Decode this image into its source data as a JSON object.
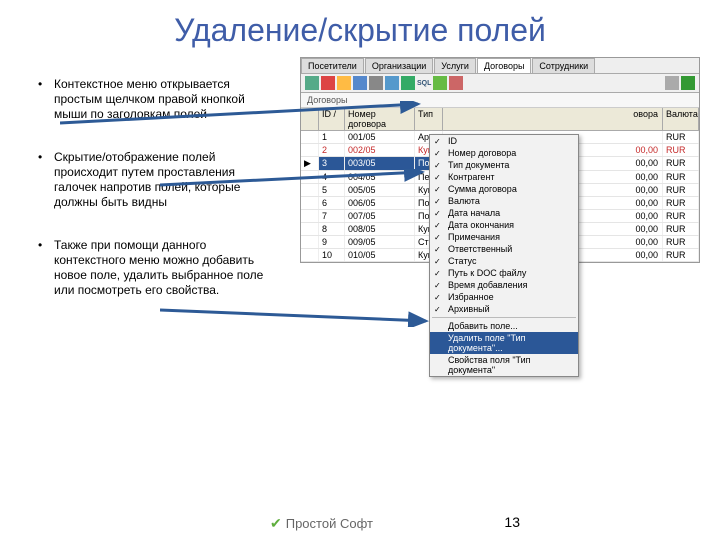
{
  "title": "Удаление/скрытие полей",
  "bullets": [
    "Контекстное меню открывается простым щелчком правой кнопкой мыши по заголовкам полей",
    "Скрытие/отображение полей происходит путем проставления галочек напротив полей, которые должны быть видны",
    "Также при помощи данного контекстного меню можно добавить новое поле, удалить выбранное поле или посмотреть его свойства."
  ],
  "tabs": [
    "Посетители",
    "Организации",
    "Услуги",
    "Договоры",
    "Сотрудники"
  ],
  "section_label": "Договоры",
  "headers": {
    "id": "ID /",
    "num": "Номер договора",
    "type": "Тип",
    "sum_col": "овора",
    "cur": "Валюта"
  },
  "rows": [
    {
      "i": "1",
      "num": "001/05",
      "type": "Арен",
      "sum": "",
      "cur": "RUR"
    },
    {
      "i": "2",
      "num": "002/05",
      "type": "Купл",
      "sum": "00,00",
      "cur": "RUR",
      "red": true
    },
    {
      "i": "3",
      "num": "003/05",
      "type": "Пост",
      "sum": "00,00",
      "cur": "RUR",
      "sel": true
    },
    {
      "i": "4",
      "num": "004/05",
      "type": "Пере",
      "sum": "00,00",
      "cur": "RUR"
    },
    {
      "i": "5",
      "num": "005/05",
      "type": "Купл",
      "sum": "00,00",
      "cur": "RUR"
    },
    {
      "i": "6",
      "num": "006/05",
      "type": "Пост",
      "sum": "00,00",
      "cur": "RUR"
    },
    {
      "i": "7",
      "num": "007/05",
      "type": "Пост",
      "sum": "00,00",
      "cur": "RUR"
    },
    {
      "i": "8",
      "num": "008/05",
      "type": "Купл",
      "sum": "00,00",
      "cur": "RUR"
    },
    {
      "i": "9",
      "num": "009/05",
      "type": "Стра",
      "sum": "00,00",
      "cur": "RUR"
    },
    {
      "i": "10",
      "num": "010/05",
      "type": "Купл",
      "sum": "00,00",
      "cur": "RUR"
    }
  ],
  "menu": {
    "fields": [
      "ID",
      "Номер договора",
      "Тип документа",
      "Контрагент",
      "Сумма договора",
      "Валюта",
      "Дата начала",
      "Дата окончания",
      "Примечания",
      "Ответственный",
      "Статус",
      "Путь к DOC файлу",
      "Время добавления",
      "Избранное",
      "Архивный"
    ],
    "add": "Добавить поле...",
    "del": "Удалить поле \"Тип документа\"...",
    "props": "Свойства поля \"Тип документа\""
  },
  "footer_brand": "Простой Софт",
  "page": "13"
}
